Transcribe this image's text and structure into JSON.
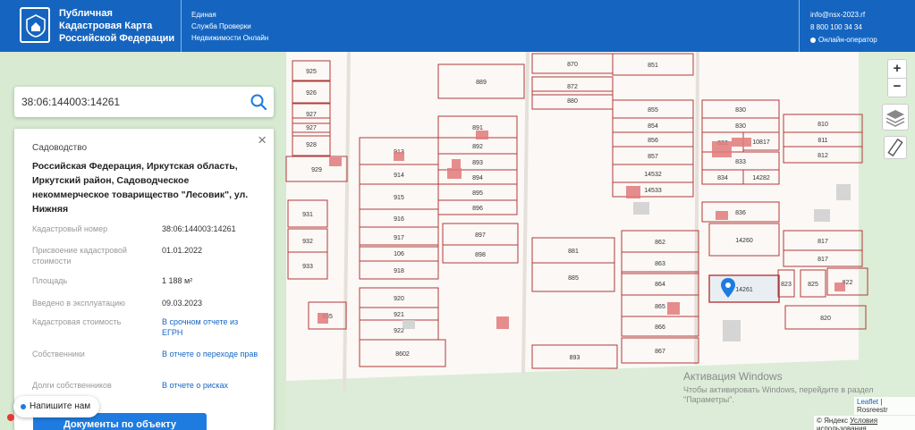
{
  "header": {
    "brand_line1": "Публичная",
    "brand_line2": "Кадастровая Карта",
    "brand_line3": "Российской Федерации",
    "service_line1": "Единая",
    "service_line2": "Служба Проверки",
    "service_line3": "Недвижимости Онлайн",
    "email": "info@nsx-2023.rf",
    "phone": "8 800 100 34 34",
    "online_operator": "Онлайн-оператор",
    "brand_color": "#1565c0"
  },
  "search": {
    "value": "38:06:144003:14261",
    "icon": "search-icon"
  },
  "panel": {
    "category": "Садоводство",
    "address": "Российская Федерация, Иркутская область, Иркутский район, Садоводческое некоммерческое товарищество \"Лесовик\", ул. Нижняя",
    "rows": [
      {
        "label": "Кадастровый номер",
        "value": "38:06:144003:14261"
      },
      {
        "label": "Присвоение кадастровой стоимости",
        "value": "01.01.2022"
      },
      {
        "label": "Площадь",
        "value": "1 188 м²"
      },
      {
        "label": "Введено в эксплуатацию",
        "value": "09.03.2023"
      },
      {
        "label": "Кадастровая стоимость",
        "value": "В срочном отчете из ЕГРН"
      },
      {
        "label": "Собственники",
        "value": "В отчете о переходе прав"
      },
      {
        "label": "Долги собственников",
        "value": "В отчете о рисках"
      }
    ],
    "doc_button": "Документы по объекту",
    "chat_button": "Напишите нам"
  },
  "map": {
    "plots": [
      "925",
      "926",
      "927",
      "927",
      "928",
      "929",
      "931",
      "932",
      "933",
      "935",
      "913",
      "914",
      "915",
      "916",
      "917",
      "106",
      "918",
      "920",
      "921",
      "922",
      "8602",
      "889",
      "891",
      "892",
      "893",
      "894",
      "895",
      "896",
      "897",
      "898",
      "870",
      "872",
      "880",
      "881",
      "885",
      "893",
      "851",
      "855",
      "854",
      "856",
      "857",
      "14532",
      "14533",
      "862",
      "863",
      "864",
      "865",
      "866",
      "867",
      "830",
      "830",
      "832",
      "10817",
      "833",
      "834",
      "14282",
      "836",
      "14260",
      "14261",
      "810",
      "811",
      "812",
      "817",
      "817",
      "822",
      "823",
      "825",
      "820"
    ],
    "selected": "14261",
    "zoom_in": "+",
    "zoom_out": "−",
    "windows_activation_title": "Активация Windows",
    "windows_activation_text": "Чтобы активировать Windows, перейдите в раздел \"Параметры\".",
    "attribution_leaflet": "Leaflet",
    "attribution_rosreestr": "Rosreestr",
    "yandex_copyright": "© Яндекс",
    "yandex_terms": "Условия использования"
  }
}
